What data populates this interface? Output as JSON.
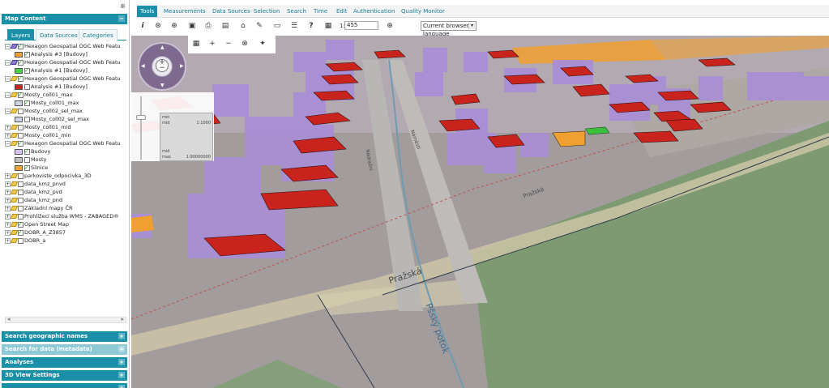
{
  "left_panel": {
    "collapse_icon": "⊕",
    "header": "Map Content",
    "tabs": [
      "Layers",
      "Data Sources",
      "Categories"
    ],
    "tree": [
      {
        "indent": 0,
        "expander": "−",
        "icon": "wms",
        "checked": true,
        "label": "Hexagon Geospatial OGC Web Featu"
      },
      {
        "indent": 1,
        "swatch": "#f0a030",
        "checked": true,
        "label": "Analysis #3 [Budovy]"
      },
      {
        "indent": 0,
        "expander": "−",
        "icon": "wms",
        "checked": true,
        "label": "Hexagon Geospatial OGC Web Featu"
      },
      {
        "indent": 1,
        "swatch": "#4ad14a",
        "checked": true,
        "label": "Analysis #1 [Budovy]"
      },
      {
        "indent": 0,
        "expander": "−",
        "icon": "pen",
        "checked": true,
        "label": "Hexagon Geospatial OGC Web Featu"
      },
      {
        "indent": 1,
        "swatch": "#c8231c",
        "checked": false,
        "label": "Analysis #1 [Budovy]"
      },
      {
        "indent": 0,
        "expander": "−",
        "icon": "pen",
        "checked": true,
        "label": "Mosty_coll01_max"
      },
      {
        "indent": 1,
        "swatch": "#cdd3e6",
        "checked": true,
        "label": "Mosty_coll01_max"
      },
      {
        "indent": 0,
        "expander": "−",
        "icon": "pen",
        "checked": false,
        "label": "Mosty_coll02_sel_max"
      },
      {
        "indent": 1,
        "swatch": "#cdd3e6",
        "checked": false,
        "label": "Mosty_coll02_sel_max"
      },
      {
        "indent": 0,
        "expander": "+",
        "icon": "pen",
        "checked": false,
        "label": "Mosty_coll01_mid"
      },
      {
        "indent": 0,
        "expander": "+",
        "icon": "pen",
        "checked": false,
        "label": "Mosty_coll01_min"
      },
      {
        "indent": 0,
        "expander": "−",
        "icon": "pen",
        "checked": true,
        "label": "Hexagon Geospatial OGC Web Featu"
      },
      {
        "indent": 1,
        "swatch": "#d8c4ec",
        "checked": true,
        "label": "Budovy"
      },
      {
        "indent": 1,
        "swatch": "#bfbfbf",
        "checked": false,
        "label": "Mosty"
      },
      {
        "indent": 1,
        "swatch": "#f0a030",
        "checked": true,
        "label": "Silnice"
      },
      {
        "indent": 0,
        "expander": "+",
        "icon": "pen",
        "checked": false,
        "label": "parkoviste_odpocivka_3D"
      },
      {
        "indent": 0,
        "expander": "+",
        "icon": "pen",
        "checked": false,
        "label": "data_kmz_pnvd"
      },
      {
        "indent": 0,
        "expander": "+",
        "icon": "pen",
        "checked": false,
        "label": "data_kmz_pvd"
      },
      {
        "indent": 0,
        "expander": "+",
        "icon": "pen",
        "checked": false,
        "label": "data_kmz_pnd"
      },
      {
        "indent": 0,
        "expander": "+",
        "icon": "pen",
        "checked": false,
        "label": "Základní mapy ČR"
      },
      {
        "indent": 0,
        "expander": "+",
        "icon": "pen",
        "checked": false,
        "label": "Prohlížecí služba WMS - ZABAGED®"
      },
      {
        "indent": 0,
        "expander": "+",
        "icon": "pen",
        "checked": true,
        "label": "Open Street Map"
      },
      {
        "indent": 0,
        "expander": "+",
        "icon": "pen",
        "checked": true,
        "label": "DOBR_A_Z3857"
      },
      {
        "indent": 0,
        "expander": "+",
        "icon": "pen",
        "checked": false,
        "label": "DOBR_a"
      }
    ],
    "bottom_panels": [
      {
        "label": "Search geographic names",
        "light": false
      },
      {
        "label": "Search for data (metadata)",
        "light": true
      },
      {
        "label": "Analyses",
        "light": false
      },
      {
        "label": "3D View Settings",
        "light": false
      },
      {
        "label": "",
        "light": false
      }
    ]
  },
  "menu_tabs": [
    "Tools",
    "Measurements",
    "Data Sources",
    "Selection",
    "Search",
    "Time",
    "Edit",
    "Authentication",
    "Quality Monitor"
  ],
  "active_menu_tab": "Tools",
  "toolbar": {
    "icons": [
      "info-icon",
      "pan-icon",
      "zoom-in-icon",
      "save-icon",
      "print-icon",
      "export-icon",
      "home-icon",
      "draw-icon",
      "folder-icon",
      "list-icon",
      "help-icon",
      "zoom-icon"
    ],
    "scale_prefix": "1:",
    "scale_value": "455",
    "language": "Current browser language"
  },
  "map": {
    "labels": {
      "street_1": "Pražská",
      "street_2": "Pražská",
      "stream": "Pšský potok",
      "road_a": "Nádražní",
      "road_b": "Náměstí"
    },
    "scale_widget": {
      "min_label": "min",
      "mid_label": "mid",
      "mid_value": "1:1000",
      "mid2_label": "mid",
      "max_label": "max",
      "max_value": "1:90000000"
    }
  },
  "colors": {
    "accent": "#1a8fa8",
    "building_side": "#a98ed8",
    "building_roof": "#c8231c",
    "grass": "#7a9670",
    "road": "#bdb9a4"
  }
}
